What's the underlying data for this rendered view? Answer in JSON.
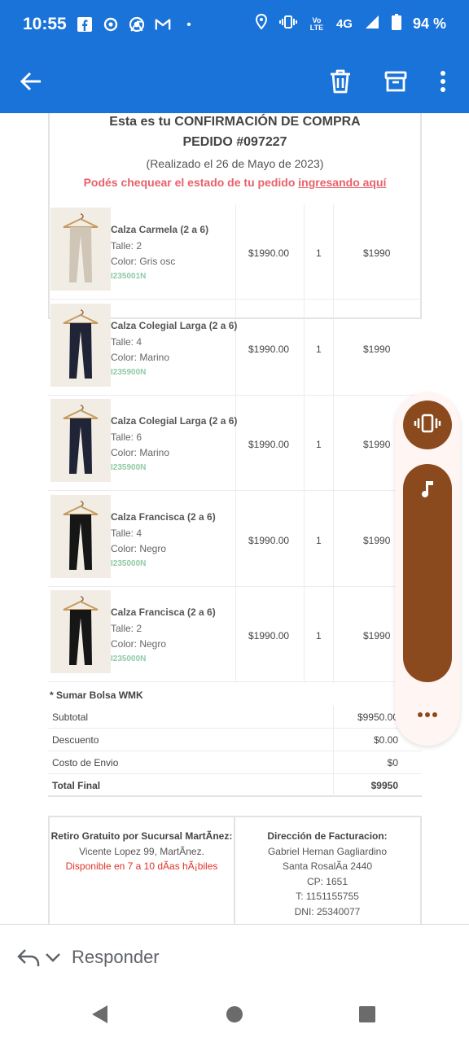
{
  "status_bar": {
    "time": "10:55",
    "notif_icons": [
      "facebook-icon",
      "instagram-icon",
      "chrome-icon",
      "gmail-icon"
    ],
    "dot": "•",
    "network": "4G",
    "volte": "Vo LTE",
    "battery": "94 %"
  },
  "app_bar": {
    "back": "back-arrow-icon",
    "actions": [
      "trash-icon",
      "archive-icon",
      "more-vert-icon"
    ],
    "color": "#1a73d9"
  },
  "email": {
    "header": {
      "line1": "Esta es tu CONFIRMACIÓN DE COMPRA",
      "line2": "PEDIDO #097227",
      "line3": "(Realizado el 26 de Mayo de 2023)",
      "line4_prefix": "Podés chequear el estado de tu pedido ",
      "line4_link": "ingresando aquí"
    },
    "items": [
      {
        "name": "Calza Carmela (2 a 6)",
        "talle": "Talle: 2",
        "color": "Color: Gris osc",
        "sku": "I235001N",
        "price": "$1990.00",
        "qty": "1",
        "total": "$1990",
        "pant_color": "#cfc6b8"
      },
      {
        "name": "Calza Colegial Larga (2 a 6)",
        "talle": "Talle: 4",
        "color": "Color: Marino",
        "sku": "I235900N",
        "price": "$1990.00",
        "qty": "1",
        "total": "$1990",
        "pant_color": "#1f2437"
      },
      {
        "name": "Calza Colegial Larga (2 a 6)",
        "talle": "Talle: 6",
        "color": "Color: Marino",
        "sku": "I235900N",
        "price": "$1990.00",
        "qty": "1",
        "total": "$1990",
        "pant_color": "#1f2437"
      },
      {
        "name": "Calza Francisca (2 a 6)",
        "talle": "Talle: 4",
        "color": "Color: Negro",
        "sku": "I235000N",
        "price": "$1990.00",
        "qty": "1",
        "total": "$1990",
        "pant_color": "#161616"
      },
      {
        "name": "Calza Francisca (2 a 6)",
        "talle": "Talle: 2",
        "color": "Color: Negro",
        "sku": "I235000N",
        "price": "$1990.00",
        "qty": "1",
        "total": "$1990",
        "pant_color": "#161616"
      }
    ],
    "bolsa": "* Sumar Bolsa WMK",
    "summary": [
      {
        "label": "Subtotal",
        "value": "$9950.00"
      },
      {
        "label": "Descuento",
        "value": "$0.00"
      },
      {
        "label": "Costo de Envio",
        "value": "$0"
      },
      {
        "label": "Total Final",
        "value": "$9950"
      }
    ],
    "pickup": {
      "title": "Retiro Gratuito por Sucursal MartÃ­nez:",
      "address": "Vicente Lopez 99, MartÃ­nez.",
      "availability": "Disponible en 7 a 10 dÃ­as hÃ¡biles"
    },
    "billing": {
      "title": "Dirección de Facturacion:",
      "name": "Gabriel Hernan Gagliardino",
      "street": "Santa RosalÃ­a 2440",
      "cp": "CP: 1651",
      "phone": "T: 1151155755",
      "dni": "DNI: 25340077"
    }
  },
  "floating_panel": {
    "vibrate_icon": "vibrate-icon",
    "music_icon": "music-note-icon",
    "more_icon": "more-horiz-icon",
    "accent": "#8b4a1e"
  },
  "reply_bar": {
    "reply_icon": "reply-icon",
    "chevron_icon": "chevron-down-icon",
    "label": "Responder"
  },
  "nav_bar": {
    "buttons": [
      "back-triangle-icon",
      "home-circle-icon",
      "recents-square-icon"
    ]
  }
}
